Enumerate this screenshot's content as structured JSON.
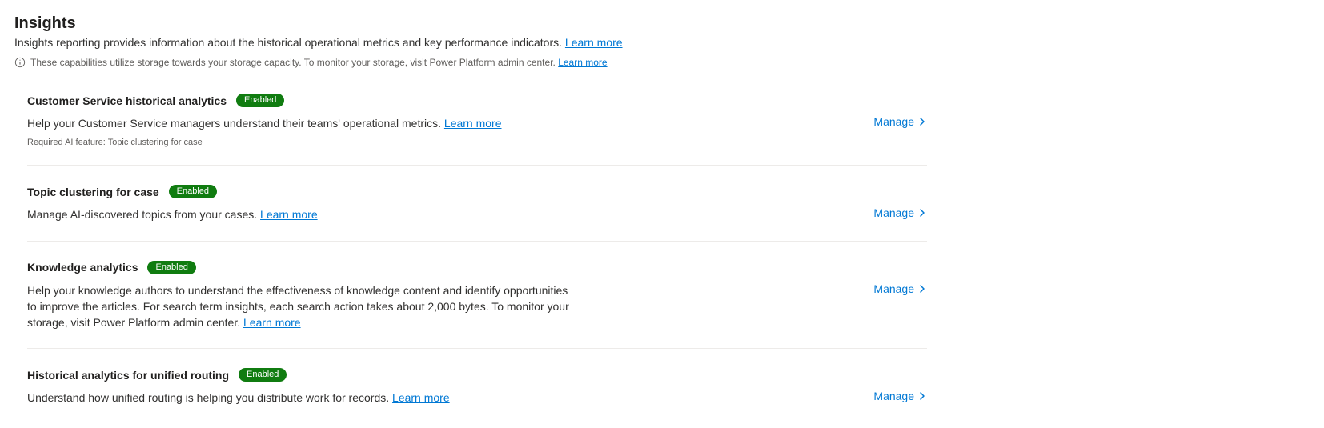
{
  "header": {
    "title": "Insights",
    "subtitle": "Insights reporting provides information about the historical operational metrics and key performance indicators. ",
    "learn_more": "Learn more"
  },
  "info_bar": {
    "text": "These capabilities utilize storage towards your storage capacity. To monitor your storage, visit Power Platform admin center. ",
    "learn_more": "Learn more"
  },
  "badge_enabled": "Enabled",
  "manage_label": "Manage",
  "sections": [
    {
      "title": "Customer Service historical analytics",
      "desc": "Help your Customer Service managers understand their teams' operational metrics. ",
      "learn_more": "Learn more",
      "note": "Required AI feature: Topic clustering for case"
    },
    {
      "title": "Topic clustering for case",
      "desc": "Manage AI-discovered topics from your cases. ",
      "learn_more": "Learn more",
      "note": ""
    },
    {
      "title": "Knowledge analytics",
      "desc": "Help your knowledge authors to understand the effectiveness of knowledge content and identify opportunities to improve the articles. For search term insights, each search action takes about 2,000 bytes. To monitor your storage, visit Power Platform admin center. ",
      "learn_more": "Learn more",
      "note": ""
    },
    {
      "title": "Historical analytics for unified routing",
      "desc": "Understand how unified routing is helping you distribute work for records. ",
      "learn_more": "Learn more",
      "note": ""
    }
  ]
}
